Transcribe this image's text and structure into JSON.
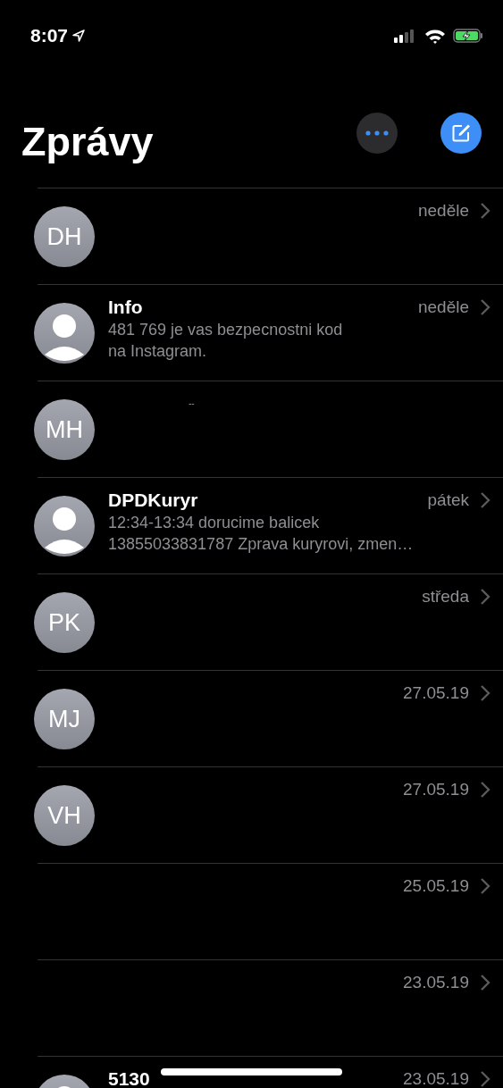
{
  "status_bar": {
    "time": "8:07",
    "location": true
  },
  "header": {
    "title": "Zprávy"
  },
  "conversations": [
    {
      "kind": "initials",
      "initials": "DH",
      "date": "neděle"
    },
    {
      "kind": "person",
      "name": "Info",
      "date": "neděle",
      "preview_lines": [
        "481 769 je vas bezpecnostni kod",
        "na Instagram."
      ]
    },
    {
      "kind": "initials",
      "initials": "MH",
      "name": "--"
    },
    {
      "kind": "person",
      "name": "DPDKuryr",
      "date": "pátek",
      "preview_lines": [
        "12:34-13:34 dorucime balicek",
        "13855033831787 Zprava kuryrovi, zmen…"
      ]
    },
    {
      "kind": "initials",
      "initials": "PK",
      "date": "středa"
    },
    {
      "kind": "initials",
      "initials": "MJ",
      "date": "27.05.19"
    },
    {
      "kind": "initials",
      "initials": "VH",
      "date": "27.05.19"
    },
    {
      "kind": "none",
      "date": "25.05.19"
    },
    {
      "kind": "none",
      "date": "23.05.19"
    },
    {
      "kind": "person",
      "name": "5130",
      "date": "23.05.19"
    }
  ]
}
